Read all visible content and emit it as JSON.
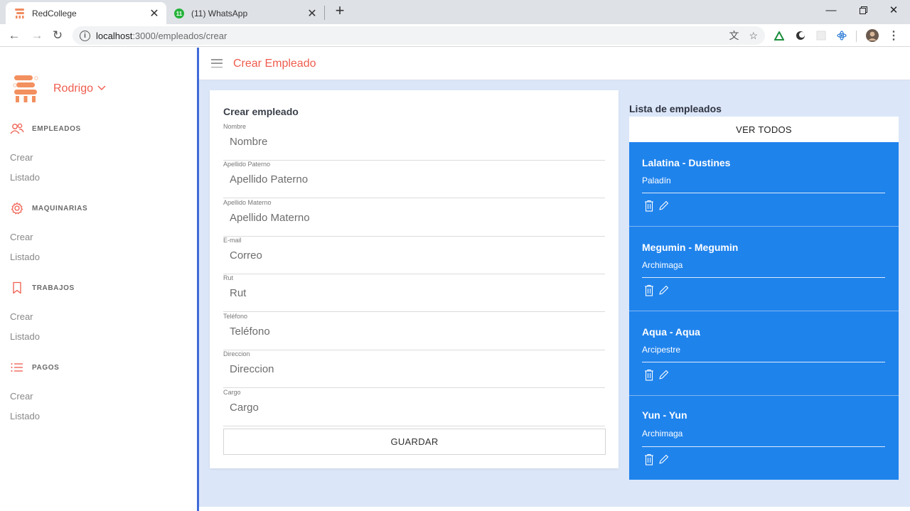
{
  "browser": {
    "tabs": [
      {
        "title": "RedCollege",
        "active": true
      },
      {
        "title": "(11) WhatsApp",
        "badge": "11",
        "active": false
      }
    ],
    "url_host": "localhost",
    "url_path": ":3000/empleados/crear"
  },
  "sidebar": {
    "user_name": "Rodrigo",
    "sections": [
      {
        "label": "EMPLEADOS",
        "icon": "users-icon",
        "links": [
          "Crear",
          "Listado"
        ]
      },
      {
        "label": "MAQUINARIAS",
        "icon": "gear-icon",
        "links": [
          "Crear",
          "Listado"
        ]
      },
      {
        "label": "TRABAJOS",
        "icon": "bookmark-icon",
        "links": [
          "Crear",
          "Listado"
        ]
      },
      {
        "label": "PAGOS",
        "icon": "list-icon",
        "links": [
          "Crear",
          "Listado"
        ]
      }
    ]
  },
  "header": {
    "title": "Crear Empleado"
  },
  "form": {
    "title": "Crear empleado",
    "fields": [
      {
        "label": "Nombre",
        "placeholder": "Nombre",
        "value": ""
      },
      {
        "label": "Apellido Paterno",
        "placeholder": "Apellido Paterno",
        "value": ""
      },
      {
        "label": "Apellido Materno",
        "placeholder": "Apellido Materno",
        "value": ""
      },
      {
        "label": "E-mail",
        "placeholder": "Correo",
        "value": ""
      },
      {
        "label": "Rut",
        "placeholder": "Rut",
        "value": ""
      },
      {
        "label": "Teléfono",
        "placeholder": "Teléfono",
        "value": ""
      },
      {
        "label": "Direccion",
        "placeholder": "Direccion",
        "value": ""
      },
      {
        "label": "Cargo",
        "placeholder": "Cargo",
        "value": ""
      }
    ],
    "save_label": "GUARDAR"
  },
  "employees": {
    "title": "Lista de empleados",
    "see_all_label": "VER TODOS",
    "items": [
      {
        "name": "Lalatina - Dustines",
        "role": "Paladín"
      },
      {
        "name": "Megumin - Megumin",
        "role": "Archimaga"
      },
      {
        "name": "Aqua - Aqua",
        "role": "Arcipestre"
      },
      {
        "name": "Yun - Yun",
        "role": "Archimaga"
      }
    ]
  },
  "colors": {
    "accent": "#ef5c4e",
    "card_blue": "#1f83ec",
    "main_bg": "#dbe6f8",
    "sidebar_border": "#3f6ad8"
  }
}
